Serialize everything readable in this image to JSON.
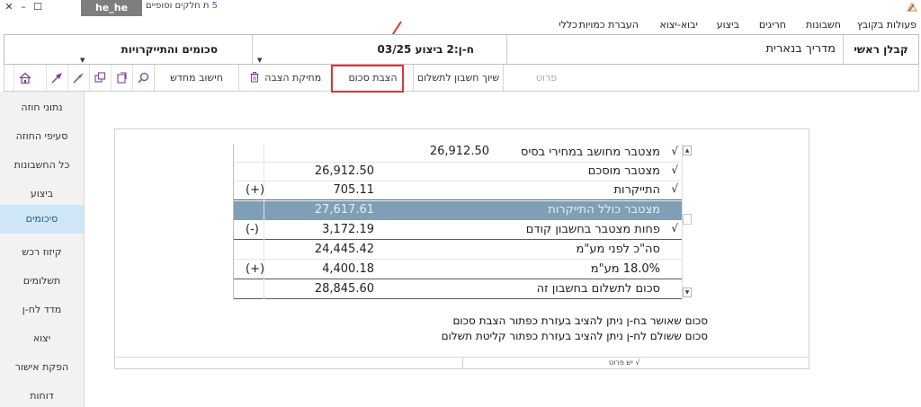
{
  "titlebar": {
    "controls": [
      "✕",
      "–",
      "☐"
    ],
    "grey_label": "he_he",
    "title": "ת חלקים וסופיים",
    "version": "5"
  },
  "menu": {
    "items": [
      "פעולות בקובץ",
      "חשבונות",
      "חריגים",
      "ביצוע",
      "יבוא-יצוא",
      "העברת כמויות",
      "כללי"
    ]
  },
  "selection": {
    "role": "קבלן ראשי",
    "project": "מדריך בנארית",
    "period": "ח-ן:2 ביצוע 03/25",
    "view": "סכומים והתייקרויות"
  },
  "toolbar": {
    "details": "פרוט",
    "assign_account": "שיוך חשבון לתשלום",
    "show_amount": "הצבת סכום",
    "delete_placement": "מחיקת הצבה",
    "recalc": "חישוב מחדש"
  },
  "sidebar": {
    "items": [
      "נתוני חוזה",
      "סעיפי החוזה",
      "כל החשבונות",
      "ביצוע",
      "סיכומים",
      "קיזוז רכש",
      "תשלומים",
      "מדד לח-ן",
      "יצוא",
      "הפקת אישור",
      "דוחות"
    ],
    "active": "סיכומים"
  },
  "summary": {
    "rows": [
      {
        "check": "√",
        "label": "מצטבר מחושב במחירי בסיס",
        "base_value": "26,912.50",
        "value": "",
        "sign": ""
      },
      {
        "check": "√",
        "label": "מצטבר מוסכם",
        "base_value": "",
        "value": "26,912.50",
        "sign": ""
      },
      {
        "check": "√",
        "label": "התייקרות",
        "base_value": "",
        "value": "705.11",
        "sign": "(+)"
      },
      {
        "check": "",
        "label": "מצטבר כולל התייקרות",
        "base_value": "",
        "value": "27,617.61",
        "sign": ""
      },
      {
        "check": "√",
        "label": "פחות מצטבר בחשבון קודם",
        "base_value": "",
        "value": "3,172.19",
        "sign": "(-)"
      },
      {
        "check": "",
        "label": "סה\"כ לפני מע\"מ",
        "base_value": "",
        "value": "24,445.42",
        "sign": ""
      },
      {
        "check": "",
        "label": "18.0% מע\"מ",
        "base_value": "",
        "value": "4,400.18",
        "sign": "(+)"
      },
      {
        "check": "",
        "label": "סכום לתשלום בחשבון זה",
        "base_value": "",
        "value": "28,845.60",
        "sign": ""
      }
    ]
  },
  "notes": {
    "line1": "סכום שאושר בח-ן ניתן להציב בעזרת כפתור הצבת סכום",
    "line2": "סכום ששולם לח-ן ניתן להציב בעזרת כפתור קליטת תשלום"
  },
  "footer": {
    "details_check": "√",
    "details_label": "יש פרוט"
  },
  "colors": {
    "accent": "#7e9fb6",
    "highlight_border": "#e03434",
    "sidebar_active": "#cfe6f7",
    "icon_purple": "#7a3fa0"
  }
}
